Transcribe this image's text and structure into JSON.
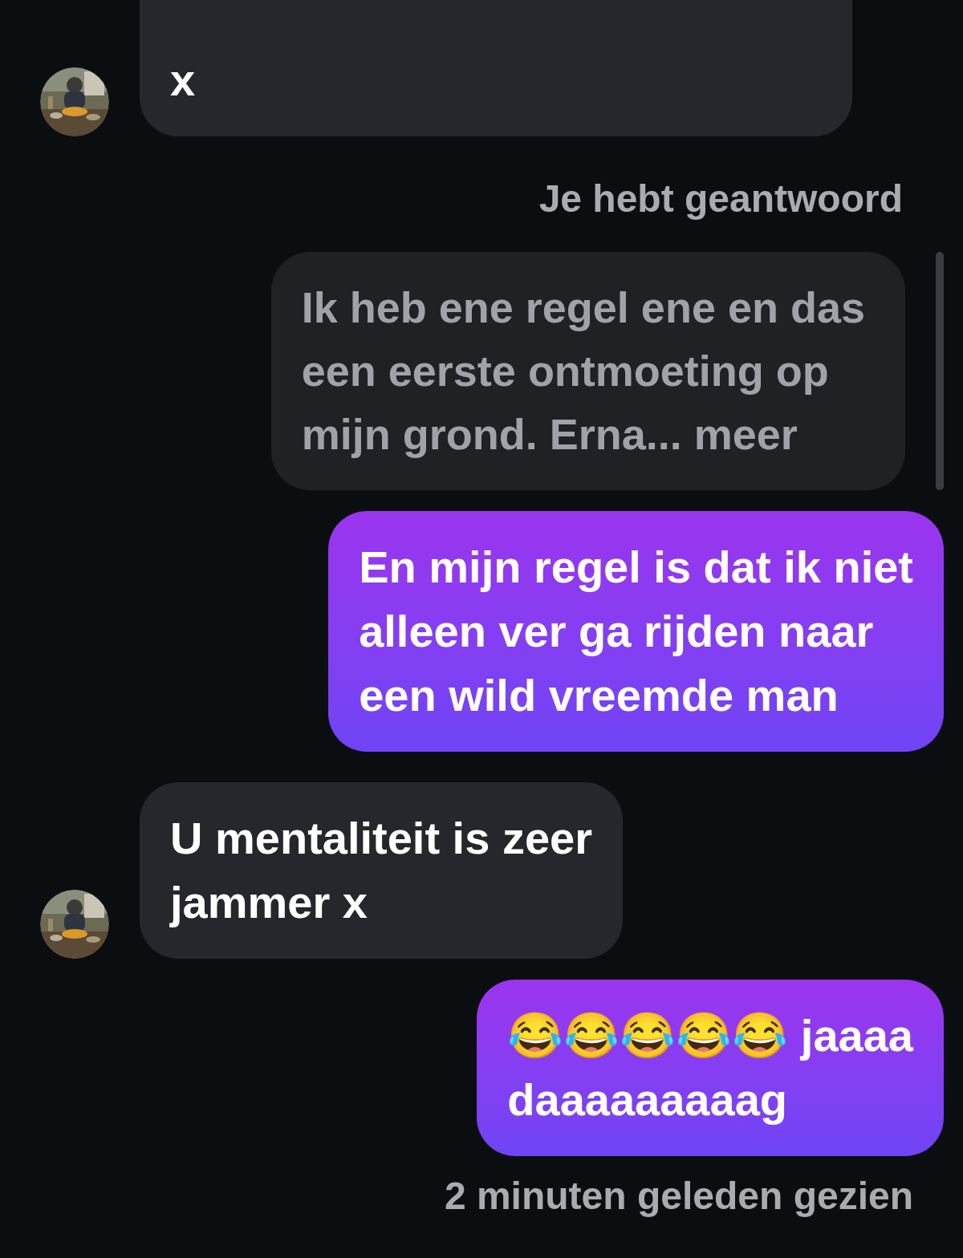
{
  "messages": [
    {
      "kind": "received",
      "avatar": true,
      "lines": [
        "x"
      ]
    },
    {
      "kind": "status",
      "text": "Je hebt geantwoord"
    },
    {
      "kind": "quoted",
      "lines": [
        "Ik heb ene regel ene en das",
        "een eerste ontmoeting op",
        "mijn grond. Erna... meer"
      ]
    },
    {
      "kind": "sent",
      "lines": [
        "En mijn regel is dat ik niet",
        "alleen ver ga rijden naar",
        "een wild vreemde man"
      ]
    },
    {
      "kind": "received",
      "avatar": true,
      "lines": [
        "U mentaliteit is zeer",
        "jammer x"
      ]
    },
    {
      "kind": "sent",
      "lines": [
        "😂😂😂😂😂 jaaaa",
        "daaaaaaaaag"
      ]
    },
    {
      "kind": "seen",
      "text": "2 minuten geleden gezien"
    }
  ]
}
